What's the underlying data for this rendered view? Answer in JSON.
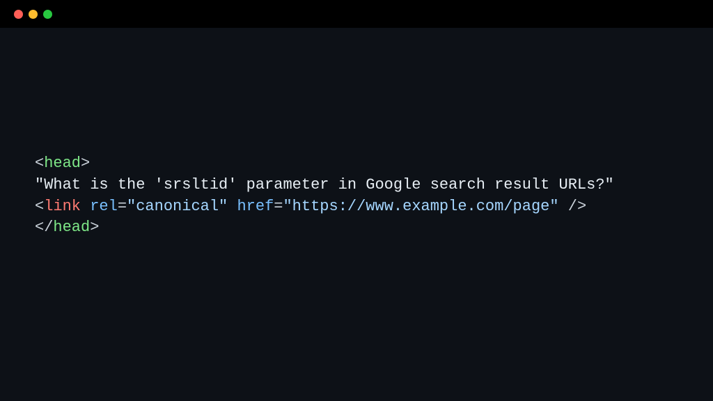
{
  "titlebar": {
    "close_label": "",
    "minimize_label": "",
    "maximize_label": ""
  },
  "code": {
    "line1": {
      "open_bracket": "<",
      "tag": "head",
      "close_bracket": ">"
    },
    "line2": {
      "text": "\"What is the 'srsltid' parameter in Google search result URLs?\""
    },
    "line3": {
      "open_bracket": "<",
      "tag": "link",
      "attr1_name": "rel",
      "eq1": "=",
      "attr1_value": "\"canonical\"",
      "attr2_name": "href",
      "eq2": "=",
      "attr2_value": "\"https://www.example.com/page\"",
      "self_close": " />"
    },
    "line4": {
      "open_bracket": "<",
      "slash": "/",
      "tag": "head",
      "close_bracket": ">"
    }
  }
}
